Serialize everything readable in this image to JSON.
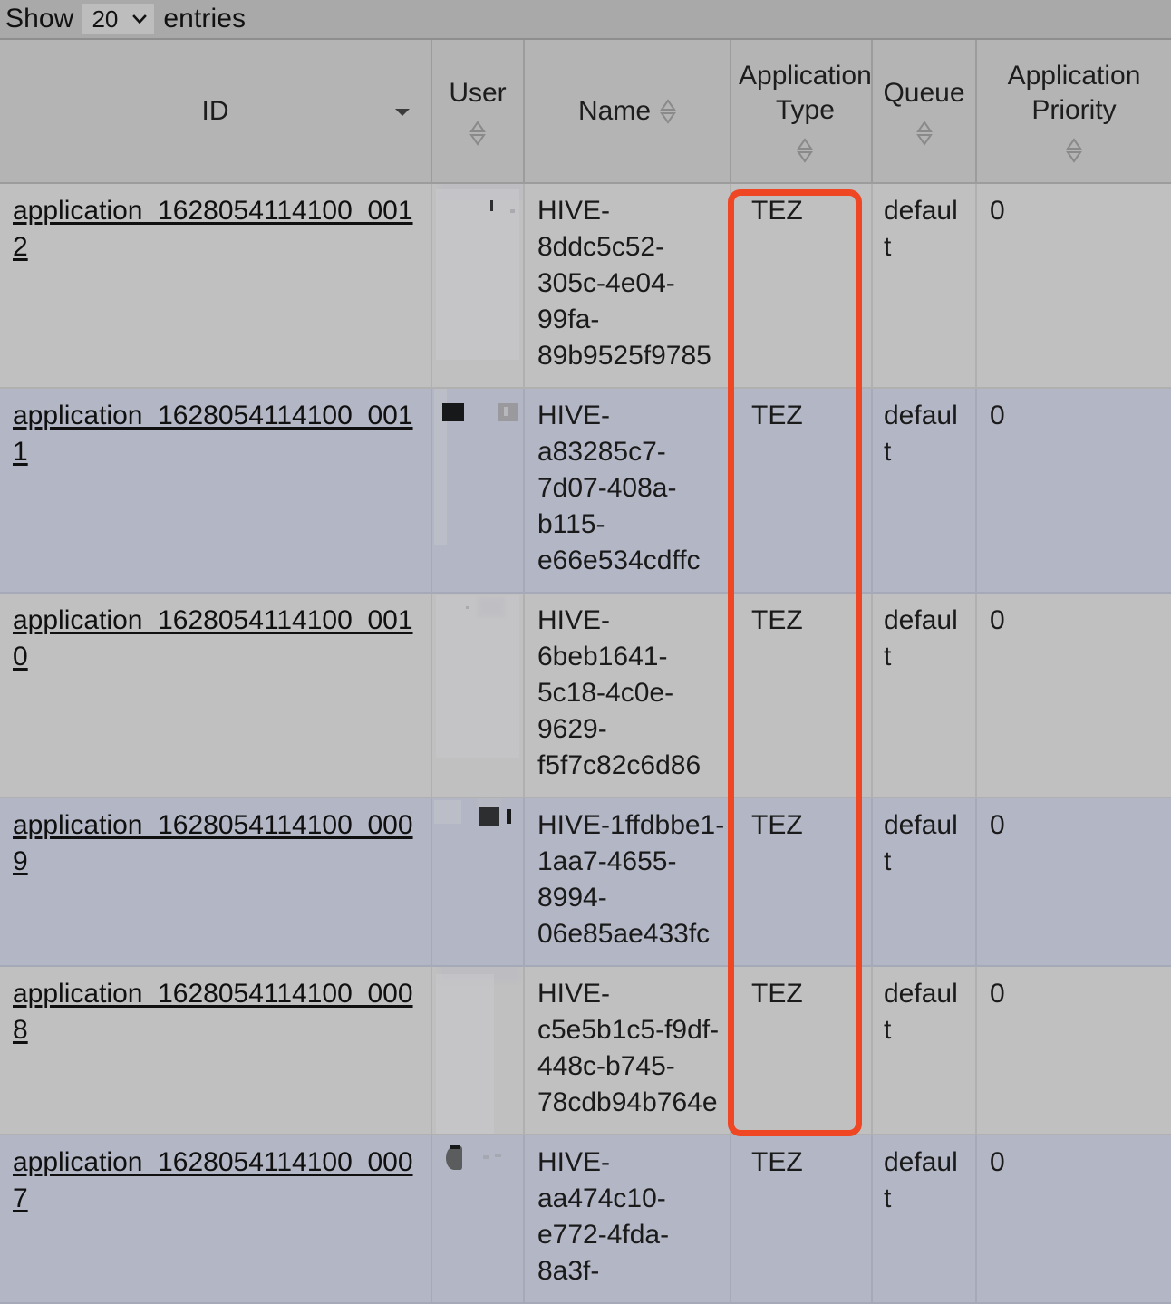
{
  "toolbar": {
    "show_label": "Show",
    "entries_label": "entries",
    "page_length_value": "20",
    "page_length_options": [
      "20"
    ],
    "chevron_icon": "chevron-down-icon"
  },
  "table": {
    "columns": [
      {
        "key": "id",
        "label": "ID",
        "sort_state": "desc",
        "sort_icon": "sort-descending-icon"
      },
      {
        "key": "user",
        "label": "User",
        "sort_state": "none",
        "sort_icon": "sort-both-icon"
      },
      {
        "key": "name",
        "label": "Name",
        "sort_state": "none",
        "sort_icon": "sort-both-icon"
      },
      {
        "key": "type",
        "label": "Application Type",
        "sort_state": "none",
        "sort_icon": "sort-both-icon"
      },
      {
        "key": "queue",
        "label": "Queue",
        "sort_state": "none",
        "sort_icon": "sort-both-icon"
      },
      {
        "key": "priority",
        "label": "Application Priority",
        "sort_state": "none",
        "sort_icon": "sort-both-icon"
      }
    ],
    "rows": [
      {
        "id": "application_1628054114100_0012",
        "user": "",
        "name": "HIVE-8ddc5c52-305c-4e04-99fa-89b9525f9785",
        "type": "TEZ",
        "queue": "default",
        "priority": "0"
      },
      {
        "id": "application_1628054114100_0011",
        "user": "",
        "name": "HIVE-a83285c7-7d07-408a-b115-e66e534cdffc",
        "type": "TEZ",
        "queue": "default",
        "priority": "0"
      },
      {
        "id": "application_1628054114100_0010",
        "user": "",
        "name": "HIVE-6beb1641-5c18-4c0e-9629-f5f7c82c6d86",
        "type": "TEZ",
        "queue": "default",
        "priority": "0"
      },
      {
        "id": "application_1628054114100_0009",
        "user": "",
        "name": "HIVE-1ffdbbe1-1aa7-4655-8994-06e85ae433fc",
        "type": "TEZ",
        "queue": "default",
        "priority": "0"
      },
      {
        "id": "application_1628054114100_0008",
        "user": "",
        "name": "HIVE-c5e5b1c5-f9df-448c-b745-78cdb94b764e",
        "type": "TEZ",
        "queue": "default",
        "priority": "0"
      },
      {
        "id": "application_1628054114100_0007",
        "user": "",
        "name": "HIVE-aa474c10-e772-4fda-8a3f-",
        "type": "TEZ",
        "queue": "default",
        "priority": "0"
      }
    ]
  },
  "annotation": {
    "name": "application-type-column-highlight",
    "color": "#ef4623",
    "shape": "rounded-rectangle"
  }
}
